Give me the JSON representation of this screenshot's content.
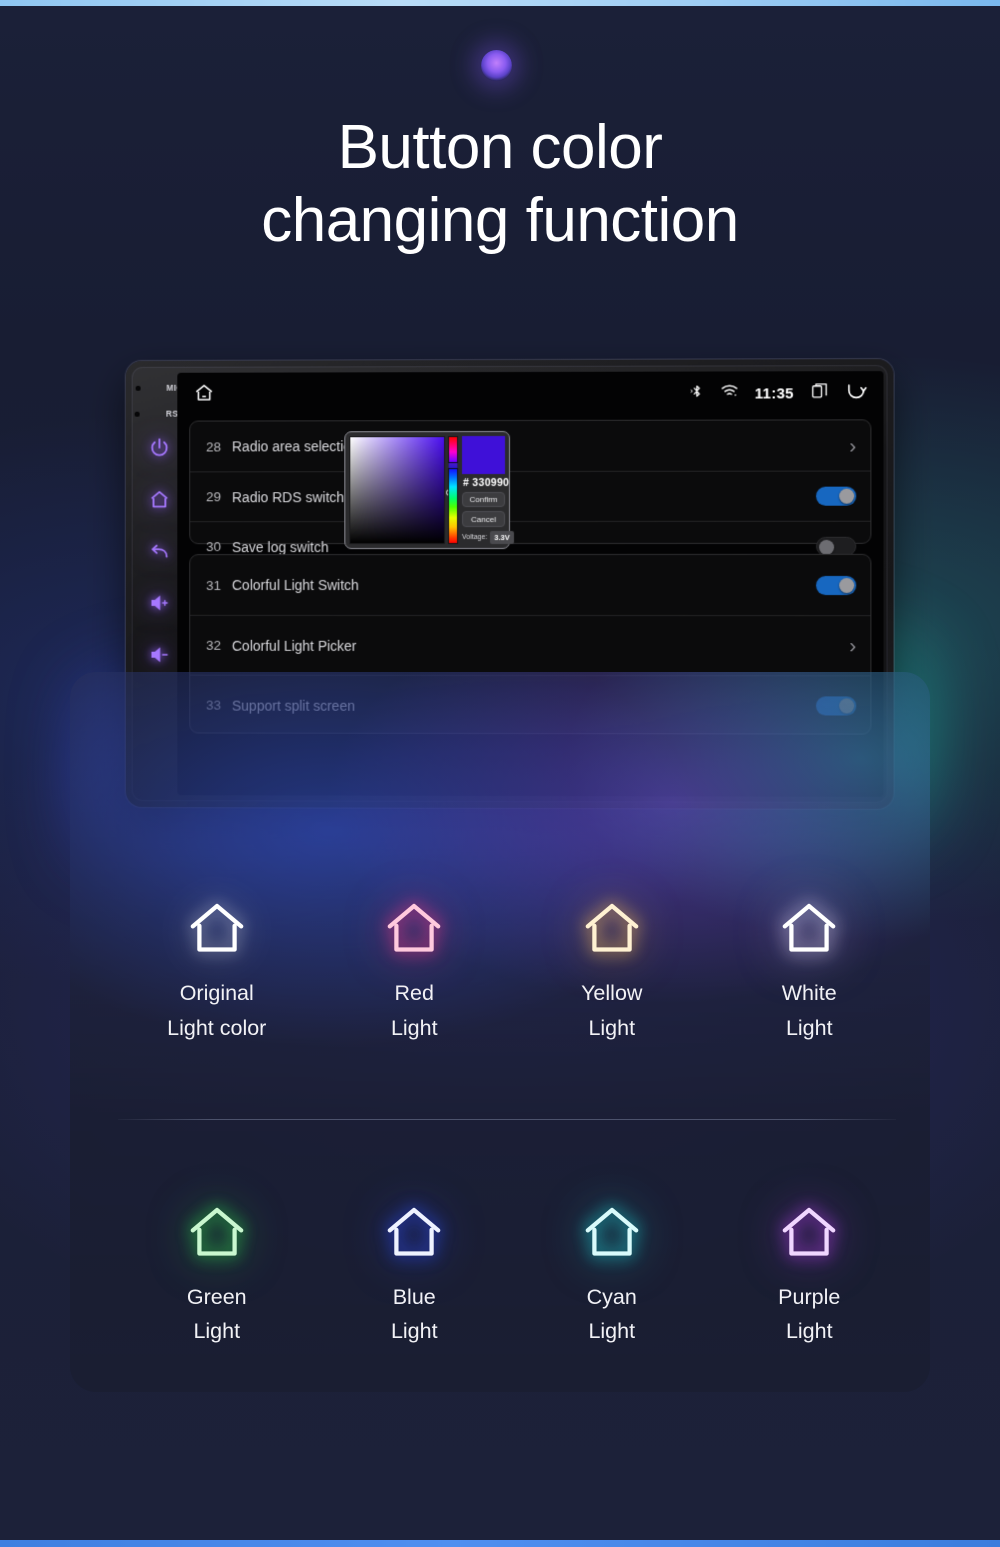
{
  "hero": {
    "title_line1": "Button color",
    "title_line2": "changing function"
  },
  "device": {
    "rail": {
      "mic_label": "MIC",
      "rst_label": "RST",
      "buttons": [
        {
          "name": "power-icon"
        },
        {
          "name": "home-icon"
        },
        {
          "name": "back-icon"
        },
        {
          "name": "volume-up-icon"
        },
        {
          "name": "volume-down-icon"
        }
      ]
    },
    "statusbar": {
      "home_icon": "home-icon",
      "bluetooth_icon": "bluetooth-icon",
      "wifi_icon": "wifi-icon",
      "time": "11:35",
      "recents_icon": "recents-icon",
      "back_icon": "back-icon"
    },
    "settings": {
      "group1": [
        {
          "num": "28",
          "label": "Radio area selection",
          "control": "chevron"
        },
        {
          "num": "29",
          "label": "Radio RDS switch",
          "control": "toggle-on"
        },
        {
          "num": "30",
          "label": "Save log switch",
          "control": "toggle-off"
        }
      ],
      "group2": [
        {
          "num": "31",
          "label": "Colorful Light Switch",
          "control": "toggle-on"
        },
        {
          "num": "32",
          "label": "Colorful Light Picker",
          "control": "chevron"
        },
        {
          "num": "33",
          "label": "Support split screen",
          "control": "toggle-on"
        }
      ]
    },
    "picker": {
      "hash_symbol": "#",
      "hex_value": "330990",
      "hex_display": "#  330990",
      "swatch_color": "#3f10d8",
      "confirm_label": "Confirm",
      "cancel_label": "Cancel",
      "voltage_label": "Voltage:",
      "voltage_value": "3.3V"
    }
  },
  "swatches": {
    "row1": [
      {
        "name": "original-light-color",
        "line1": "Original",
        "line2": "Light color",
        "color": "#ffffff",
        "glow": "rgba(255,255,255,0.55)"
      },
      {
        "name": "red-light",
        "line1": "Red",
        "line2": "Light",
        "color": "#ffc9dd",
        "glow": "rgba(255,60,140,0.95)"
      },
      {
        "name": "yellow-light",
        "line1": "Yellow",
        "line2": "Light",
        "color": "#fff1d2",
        "glow": "rgba(255,195,90,0.95)"
      },
      {
        "name": "white-light",
        "line1": "White",
        "line2": "Light",
        "color": "#ffffff",
        "glow": "rgba(235,225,255,0.95)"
      }
    ],
    "row2": [
      {
        "name": "green-light",
        "line1": "Green",
        "line2": "Light",
        "color": "#c9f7cf",
        "glow": "rgba(50,225,80,0.95)"
      },
      {
        "name": "blue-light",
        "line1": "Blue",
        "line2": "Light",
        "color": "#eef2ff",
        "glow": "rgba(50,80,255,0.95)"
      },
      {
        "name": "cyan-light",
        "line1": "Cyan",
        "line2": "Light",
        "color": "#d9fbfb",
        "glow": "rgba(30,225,225,0.95)"
      },
      {
        "name": "purple-light",
        "line1": "Purple",
        "line2": "Light",
        "color": "#f0d6ff",
        "glow": "rgba(190,70,245,0.95)"
      }
    ]
  }
}
